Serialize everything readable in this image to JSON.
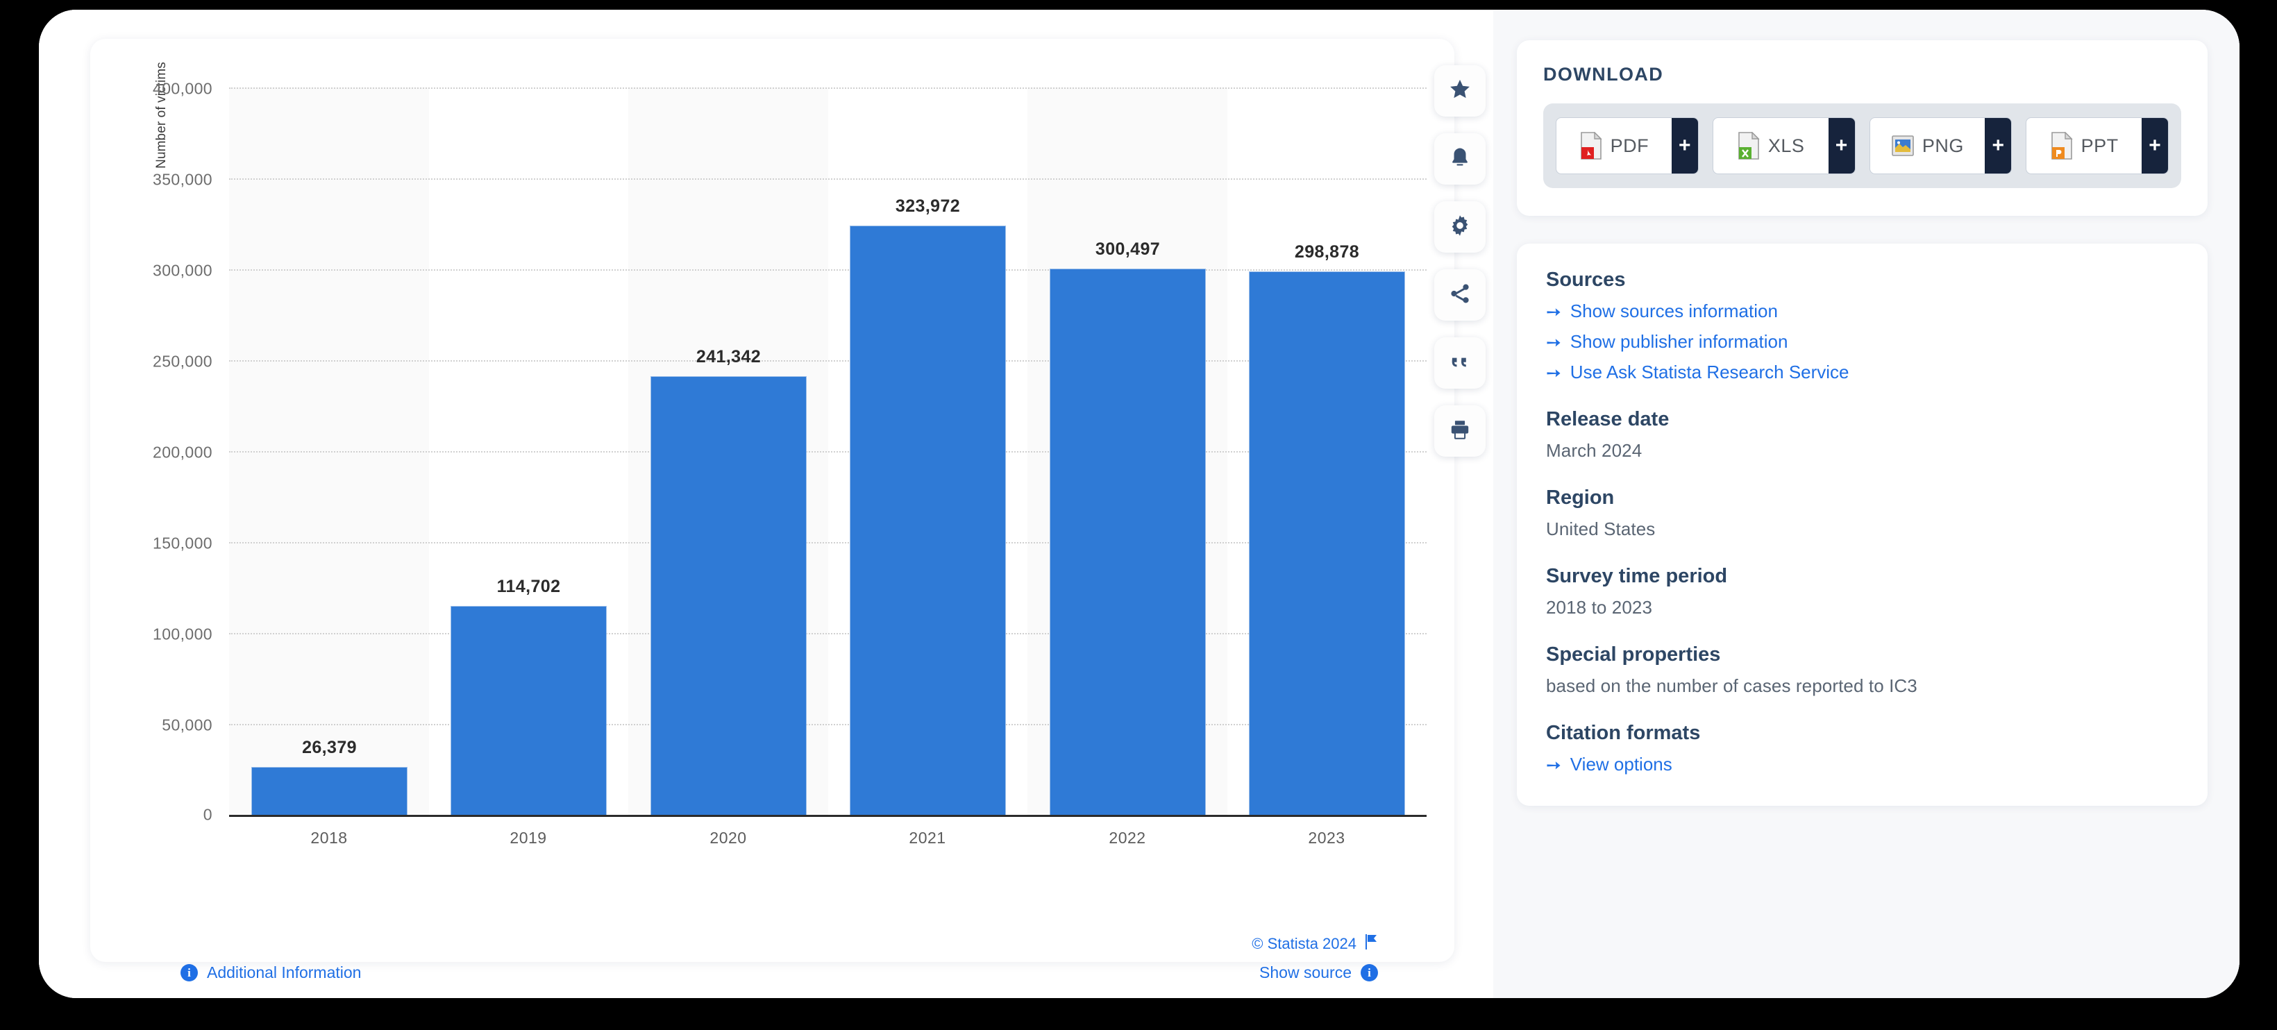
{
  "chart_data": {
    "type": "bar",
    "title": "",
    "xlabel": "",
    "ylabel": "Number of victims",
    "categories": [
      "2018",
      "2019",
      "2020",
      "2021",
      "2022",
      "2023"
    ],
    "values": [
      26379,
      114702,
      241342,
      323972,
      300497,
      298878
    ],
    "value_labels": [
      "26,379",
      "114,702",
      "241,342",
      "323,972",
      "300,497",
      "298,878"
    ],
    "ylim": [
      0,
      400000
    ],
    "yticks": [
      0,
      50000,
      100000,
      150000,
      200000,
      250000,
      300000,
      350000,
      400000
    ],
    "ytick_labels": [
      "0",
      "50,000",
      "100,000",
      "150,000",
      "200,000",
      "250,000",
      "300,000",
      "350,000",
      "400,000"
    ],
    "grid": true,
    "legend": false,
    "bar_color": "#2f7ad6",
    "alternating_band_color": "#fafafa"
  },
  "chart_toolbar": [
    {
      "name": "favorite",
      "icon": "star-icon"
    },
    {
      "name": "alert",
      "icon": "bell-icon"
    },
    {
      "name": "settings",
      "icon": "gear-icon"
    },
    {
      "name": "share",
      "icon": "share-icon"
    },
    {
      "name": "cite",
      "icon": "quote-icon"
    },
    {
      "name": "print",
      "icon": "print-icon"
    }
  ],
  "chart_footer": {
    "copyright": "© Statista 2024",
    "additional_information": "Additional Information",
    "show_source": "Show source",
    "info_glyph": "i"
  },
  "download": {
    "title": "DOWNLOAD",
    "buttons": [
      {
        "label": "PDF",
        "plus": "+",
        "icon": "pdf-file-icon"
      },
      {
        "label": "XLS",
        "plus": "+",
        "icon": "xls-file-icon"
      },
      {
        "label": "PNG",
        "plus": "+",
        "icon": "png-file-icon"
      },
      {
        "label": "PPT",
        "plus": "+",
        "icon": "ppt-file-icon"
      }
    ]
  },
  "meta": {
    "sources_heading": "Sources",
    "sources_links": [
      "Show sources information",
      "Show publisher information",
      "Use Ask Statista Research Service"
    ],
    "release_date_heading": "Release date",
    "release_date_value": "March 2024",
    "region_heading": "Region",
    "region_value": "United States",
    "survey_heading": "Survey time period",
    "survey_value": "2018 to 2023",
    "special_heading": "Special properties",
    "special_value": "based on the number of cases reported to IC3",
    "citation_heading": "Citation formats",
    "citation_link": "View options",
    "arrow_glyph": "➙"
  },
  "colors": {
    "accent_blue": "#1f6fe5",
    "bar_blue": "#2f7ad6",
    "heading_navy": "#2d4664",
    "dark_navy": "#16233c"
  }
}
